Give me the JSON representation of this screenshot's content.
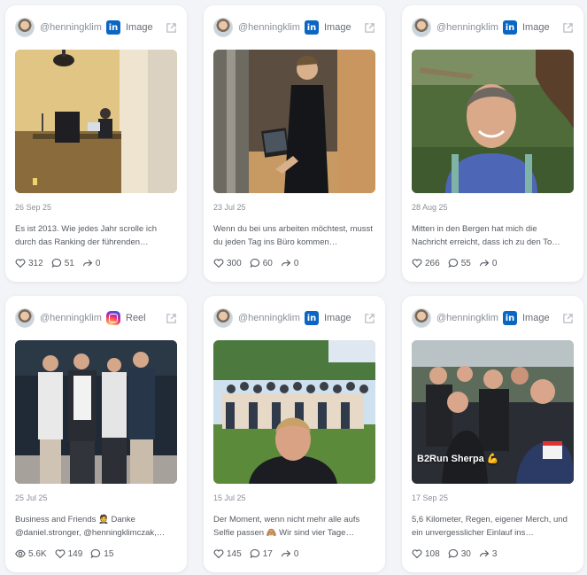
{
  "posts": [
    {
      "handle": "@henningklim",
      "platform": "linkedin",
      "type_label": "Image",
      "date": "26 Sep 25",
      "caption": "Es ist 2013. Wie jedes Jahr scrolle ich durch das Ranking der führenden…",
      "stats": [
        {
          "icon": "heart-icon",
          "value": "312"
        },
        {
          "icon": "comment-icon",
          "value": "51"
        },
        {
          "icon": "share-icon",
          "value": "0"
        }
      ]
    },
    {
      "handle": "@henningklim",
      "platform": "linkedin",
      "type_label": "Image",
      "date": "23 Jul 25",
      "caption": "Wenn du bei uns arbeiten möchtest, musst du jeden Tag ins Büro kommen…",
      "stats": [
        {
          "icon": "heart-icon",
          "value": "300"
        },
        {
          "icon": "comment-icon",
          "value": "60"
        },
        {
          "icon": "share-icon",
          "value": "0"
        }
      ]
    },
    {
      "handle": "@henningklim",
      "platform": "linkedin",
      "type_label": "Image",
      "date": "28 Aug 25",
      "caption": "Mitten in den Bergen hat mich die Nachricht erreicht, dass ich zu den To…",
      "stats": [
        {
          "icon": "heart-icon",
          "value": "266"
        },
        {
          "icon": "comment-icon",
          "value": "55"
        },
        {
          "icon": "share-icon",
          "value": "0"
        }
      ]
    },
    {
      "handle": "@henningklim",
      "platform": "instagram",
      "type_label": "Reel",
      "date": "25 Jul 25",
      "caption": "Business and Friends 🤵 Danke @daniel.stronger, @henningklimczak,…",
      "stats": [
        {
          "icon": "eye-icon",
          "value": "5.6K"
        },
        {
          "icon": "heart-icon",
          "value": "149"
        },
        {
          "icon": "comment-icon",
          "value": "15"
        }
      ]
    },
    {
      "handle": "@henningklim",
      "platform": "linkedin",
      "type_label": "Image",
      "date": "15 Jul 25",
      "caption": "Der Moment, wenn nicht mehr alle aufs Selfie passen 🙈 Wir sind vier Tage…",
      "stats": [
        {
          "icon": "heart-icon",
          "value": "145"
        },
        {
          "icon": "comment-icon",
          "value": "17"
        },
        {
          "icon": "share-icon",
          "value": "0"
        }
      ]
    },
    {
      "handle": "@henningklim",
      "platform": "linkedin",
      "type_label": "Image",
      "date": "17 Sep 25",
      "caption": "5,6 Kilometer, Regen, eigener Merch, und ein unvergesslicher Einlauf ins…",
      "overlay": "B2Run Sherpa 💪",
      "stats": [
        {
          "icon": "heart-icon",
          "value": "108"
        },
        {
          "icon": "comment-icon",
          "value": "30"
        },
        {
          "icon": "share-icon",
          "value": "3"
        }
      ]
    }
  ],
  "linkedin_glyph": "in"
}
